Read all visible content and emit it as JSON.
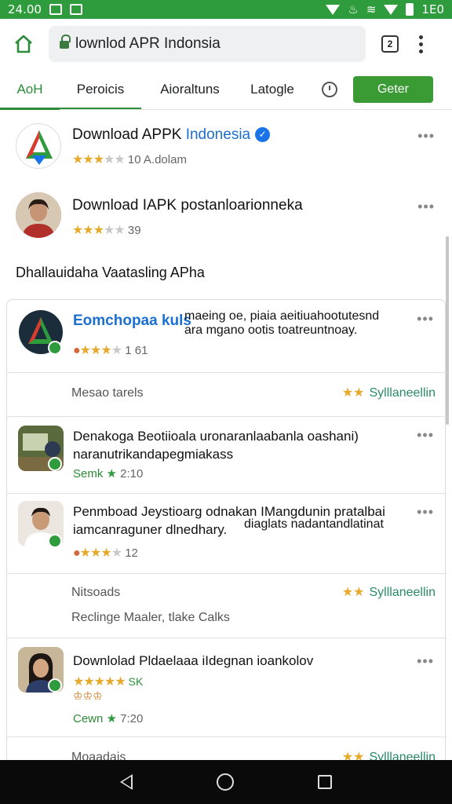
{
  "status_bar": {
    "time": "24.00",
    "right_text": "1E0"
  },
  "browser": {
    "url_text": "lownlod APR Indonsia",
    "tabs_count": "2"
  },
  "tabs": [
    {
      "label": "AoH",
      "active": true
    },
    {
      "label": "Peroicis",
      "active": false
    },
    {
      "label": "Aioraltuns",
      "active": false
    },
    {
      "label": "Latogle",
      "active": false
    }
  ],
  "get_button": "Geter",
  "apps_top": [
    {
      "title_main": "Download APPK",
      "title_blue": "Indonesia",
      "rating_value": 3.5,
      "rating_text": "10 A.dolam"
    },
    {
      "title_main": "Download IAPK postanloarionneka",
      "rating_value": 3.5,
      "rating_text": "39"
    }
  ],
  "section_title": "Dhallauidaha Vaatasling APha",
  "card": {
    "featured": {
      "title_blue": "Eomchopaa kuls",
      "desc_line1": "maeing oe, piaia aeitiuahootutesnd",
      "desc_line2": "ara mgano ootis toatreuntnoay.",
      "rating_text": "1 61",
      "footer_left": "Mesao tarels",
      "footer_right": "Sylllaneellin"
    },
    "items": [
      {
        "line1": "Denakoga Beotiioala uronaranlaabanla oashani)",
        "line2": "naranutrikandapegmiakass",
        "meta": "2:10",
        "meta_prefix": "Semk"
      },
      {
        "line1": "Penmboad Jeystioarg odnakan IMangdunin pratalbai",
        "line2": "iamcanraguner dlnedhary.",
        "line2_right": "diaglats nadantandlatinat",
        "rating_text": "12",
        "footer_left": "Nitsoads",
        "footer_right": "Sylllaneellin",
        "footer_line2": "Reclinge Maaler, tlake Calks"
      },
      {
        "line1": "Downlolad Pldaelaaa iIdegnan ioankolov",
        "rating_line": "SK",
        "meta": "7:20",
        "meta_prefix": "Cewn",
        "footer_left": "Moaadais",
        "footer_right": "Sylllaneellin"
      }
    ]
  }
}
